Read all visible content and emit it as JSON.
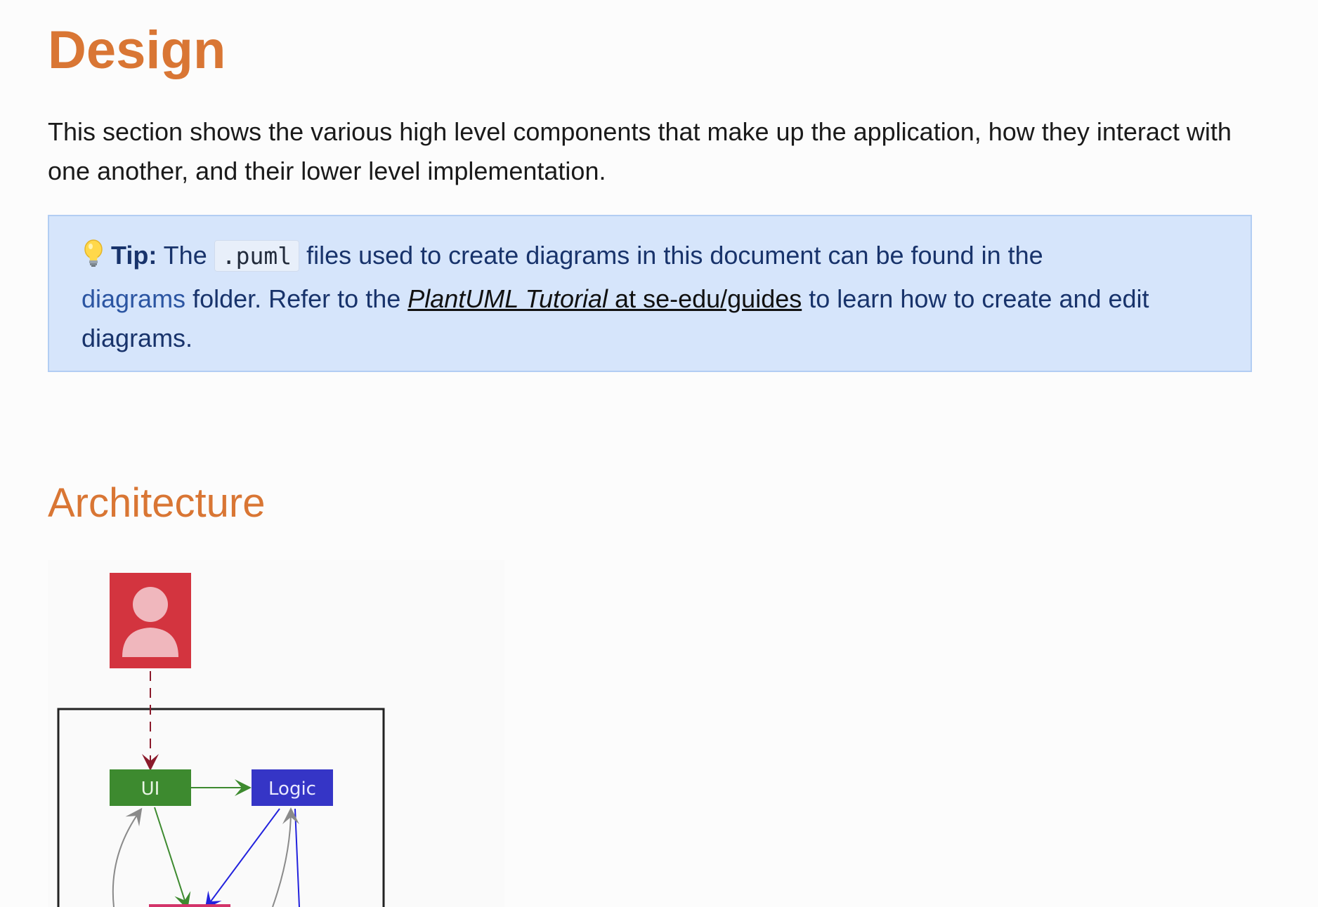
{
  "heading": "Design",
  "intro": "This section shows the various high level components that make up the application, how they interact with one another, and their lower level implementation.",
  "tip": {
    "label": "Tip:",
    "text_1": " The ",
    "code": ".puml",
    "text_2": " files used to create diagrams in this document can be found in the ",
    "folder_link": "diagrams",
    "text_3": " folder. Refer to the ",
    "tutorial_link_italic": "PlantUML Tutorial",
    "tutorial_link_rest": " at se-edu/guides",
    "text_4": " to learn how to create and edit diagrams."
  },
  "subheading": "Architecture",
  "diagram": {
    "ui_label": "UI",
    "logic_label": "Logic",
    "colors": {
      "user_box": "#d3343f",
      "ui_box": "#3d8a2f",
      "logic_box": "#3535c6",
      "user_arrow": "#8b1a2b"
    }
  }
}
